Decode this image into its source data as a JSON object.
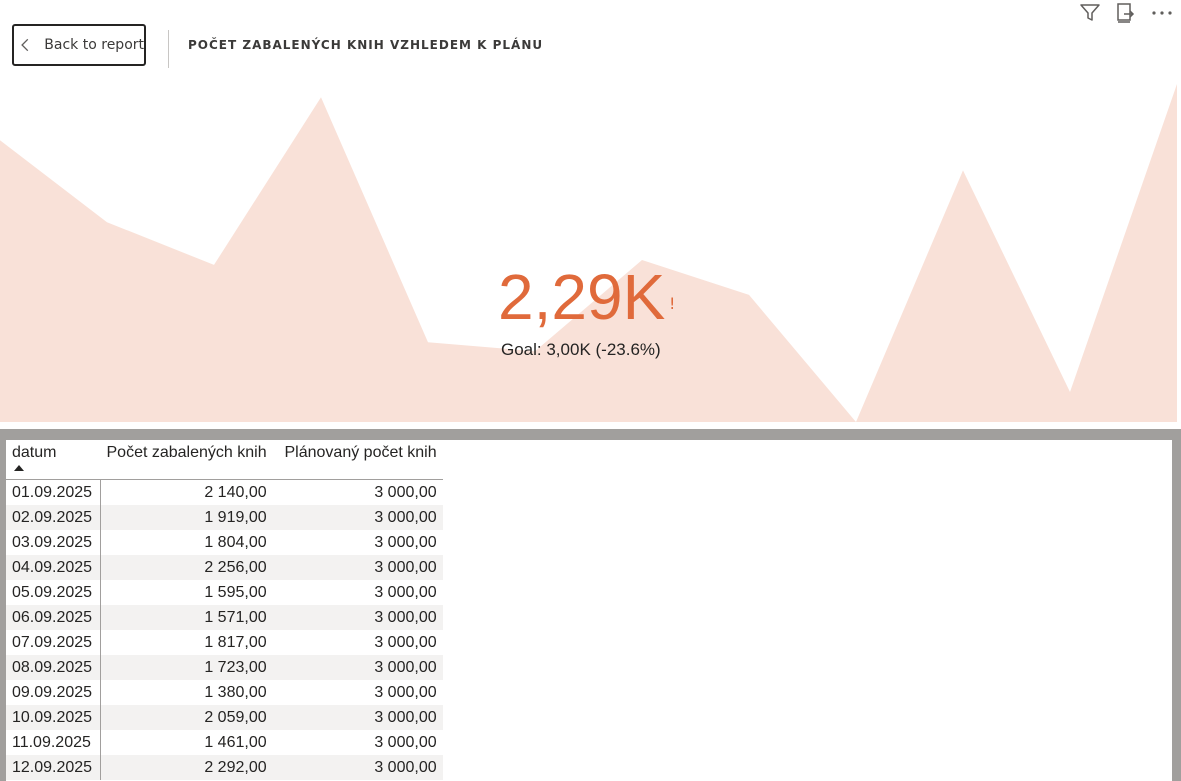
{
  "toolbar": {
    "icons": [
      "filter-icon",
      "focus-mode-icon",
      "more-options-icon"
    ]
  },
  "back_button": {
    "label": "Back to report"
  },
  "page_title": "POČET ZABALENÝCH KNIH VZHLEDEM K PLÁNU",
  "kpi": {
    "value": "2,29K",
    "flag": "!",
    "goal_text": "Goal: 3,00K (-23.6%)",
    "accent_color": "#e06a3b",
    "trend_color": "#f9e1d8"
  },
  "chart_data": {
    "type": "area",
    "title": "",
    "xlabel": "",
    "ylabel": "",
    "x": [
      "01.09.2025",
      "02.09.2025",
      "03.09.2025",
      "04.09.2025",
      "05.09.2025",
      "06.09.2025",
      "07.09.2025",
      "08.09.2025",
      "09.09.2025",
      "10.09.2025",
      "11.09.2025",
      "12.09.2025"
    ],
    "series": [
      {
        "values": [
          2140,
          1919,
          1804,
          2256,
          1595,
          1571,
          1817,
          1723,
          1380,
          2059,
          1461,
          2292
        ]
      }
    ],
    "ylim": [
      1380,
      2292
    ]
  },
  "table": {
    "columns": [
      "datum",
      "Počet zabalených knih",
      "Plánovaný počet knih"
    ],
    "sort_column": "datum",
    "sort_direction": "ascending",
    "rows": [
      [
        "01.09.2025",
        "2 140,00",
        "3 000,00"
      ],
      [
        "02.09.2025",
        "1 919,00",
        "3 000,00"
      ],
      [
        "03.09.2025",
        "1 804,00",
        "3 000,00"
      ],
      [
        "04.09.2025",
        "2 256,00",
        "3 000,00"
      ],
      [
        "05.09.2025",
        "1 595,00",
        "3 000,00"
      ],
      [
        "06.09.2025",
        "1 571,00",
        "3 000,00"
      ],
      [
        "07.09.2025",
        "1 817,00",
        "3 000,00"
      ],
      [
        "08.09.2025",
        "1 723,00",
        "3 000,00"
      ],
      [
        "09.09.2025",
        "1 380,00",
        "3 000,00"
      ],
      [
        "10.09.2025",
        "2 059,00",
        "3 000,00"
      ],
      [
        "11.09.2025",
        "1 461,00",
        "3 000,00"
      ],
      [
        "12.09.2025",
        "2 292,00",
        "3 000,00"
      ]
    ]
  }
}
